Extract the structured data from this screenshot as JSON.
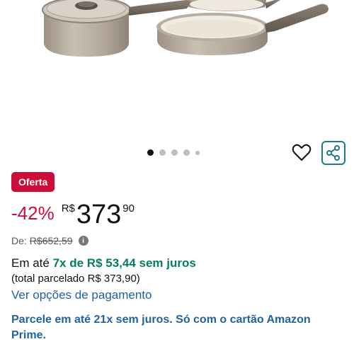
{
  "product": {
    "offer_badge": "Oferta",
    "discount": "-42%",
    "currency": "R$",
    "price_whole": "373",
    "price_fraction": "90",
    "list_price_label": "De:",
    "list_price": "R$652,59",
    "installments_prefix": "Em até",
    "installments_highlight": "7x de R$ 53,44 sem juros",
    "total_installments": "(total parcelado R$ 373,90)",
    "payment_options_link": "Ver opções de pagamento",
    "card_promo": "Parcele em até 21x sem juros. Só com o cartão Amazon Prime."
  },
  "carousel": {
    "total_dots": 5,
    "active_index": 0
  },
  "icons": {
    "favorite": "heart-icon",
    "share": "share-icon",
    "info": "info-icon"
  },
  "colors": {
    "offer_red": "#cc0c39",
    "installment_green": "#067d62",
    "link_blue": "#2162a1",
    "share_border": "#1b7a8c",
    "cookware_beige": "#b8ada1"
  }
}
